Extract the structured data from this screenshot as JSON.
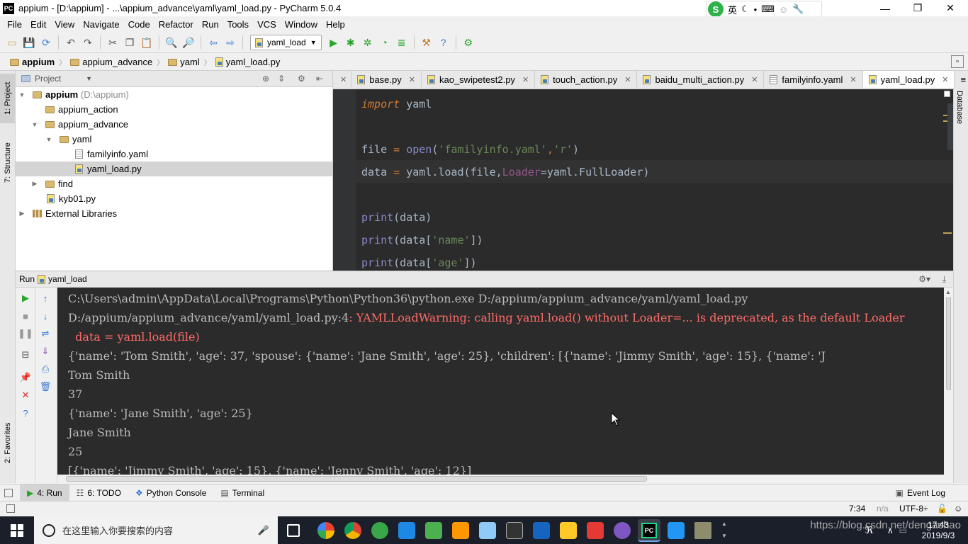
{
  "window": {
    "title": "appium - [D:\\appium] - ...\\appium_advance\\yaml\\yaml_load.py - PyCharm 5.0.4",
    "app_icon_text": "PC",
    "minimize": "—",
    "restore": "❐",
    "close": "✕"
  },
  "ime": {
    "logo": "S",
    "lang": "英",
    "icons": [
      "moon-icon",
      "dot-icon",
      "keyboard-icon",
      "person-icon",
      "wrench-icon"
    ]
  },
  "menu": [
    "File",
    "Edit",
    "View",
    "Navigate",
    "Code",
    "Refactor",
    "Run",
    "Tools",
    "VCS",
    "Window",
    "Help"
  ],
  "toolbar": {
    "run_config": "yaml_load"
  },
  "breadcrumb": [
    "appium",
    "appium_advance",
    "yaml",
    "yaml_load.py"
  ],
  "left_strip": {
    "project_tab": "1: Project",
    "structure_tab": "7: Structure",
    "favorites_tab": "2: Favorites"
  },
  "right_strip": {
    "database_tab": "Database"
  },
  "project_panel": {
    "selector": "Project",
    "tree": [
      {
        "label": "appium",
        "extra": "(D:\\appium)",
        "depth": 0,
        "expanded": true,
        "icon": "folder"
      },
      {
        "label": "appium_action",
        "depth": 1,
        "icon": "folder"
      },
      {
        "label": "appium_advance",
        "depth": 1,
        "expanded": true,
        "icon": "folder"
      },
      {
        "label": "yaml",
        "depth": 2,
        "expanded": true,
        "icon": "folder"
      },
      {
        "label": "familyinfo.yaml",
        "depth": 3,
        "icon": "yaml"
      },
      {
        "label": "yaml_load.py",
        "depth": 3,
        "icon": "py",
        "selected": true
      },
      {
        "label": "find",
        "depth": 1,
        "collapsed": true,
        "icon": "folder"
      },
      {
        "label": "kyb01.py",
        "depth": 1,
        "icon": "py"
      },
      {
        "label": "External Libraries",
        "depth": 0,
        "collapsed": true,
        "icon": "lib"
      }
    ]
  },
  "editor_tabs": [
    {
      "label": "base.py"
    },
    {
      "label": "kao_swipetest2.py"
    },
    {
      "label": "touch_action.py"
    },
    {
      "label": "baidu_multi_action.py"
    },
    {
      "label": "familyinfo.yaml",
      "icon": "yaml"
    },
    {
      "label": "yaml_load.py",
      "active": true
    }
  ],
  "tab_overflow": "≡",
  "code": {
    "l1_kw": "import",
    "l1_rest": " yaml",
    "l2_a": "file ",
    "l2_op": "=",
    "l2_fn": " open",
    "l2_b": "(",
    "l2_s1": "'familyinfo.yaml'",
    "l2_c": ",",
    "l2_s2": "'r'",
    "l2_d": ")",
    "l3_a": "data ",
    "l3_op": "=",
    "l3_b": " yaml.load(file,",
    "l3_param": "Loader",
    "l3_c": "=yaml.FullLoader)",
    "l4_fn": "print",
    "l4_b": "(data)",
    "l5_fn": "print",
    "l5_b": "(data[",
    "l5_s": "'name'",
    "l5_c": "])",
    "l6_fn": "print",
    "l6_b": "(data[",
    "l6_s": "'age'",
    "l6_c": "])"
  },
  "run_panel": {
    "label": "Run",
    "config": "yaml_load"
  },
  "console": [
    {
      "text": "C:\\Users\\admin\\AppData\\Local\\Programs\\Python\\Python36\\python.exe D:/appium/appium_advance/yaml/yaml_load.py",
      "kind": "normal"
    },
    {
      "link": "D:/appium/appium_advance/yaml/yaml_load.py:4",
      "text": ": YAMLLoadWarning: calling yaml.load() without Loader=... is deprecated, as the default Loader",
      "kind": "warn"
    },
    {
      "text": "  data = yaml.load(file)",
      "kind": "warn"
    },
    {
      "text": "{'name': 'Tom Smith', 'age': 37, 'spouse': {'name': 'Jane Smith', 'age': 25}, 'children': [{'name': 'Jimmy Smith', 'age': 15}, {'name': 'J",
      "kind": "normal"
    },
    {
      "text": "Tom Smith",
      "kind": "normal"
    },
    {
      "text": "37",
      "kind": "normal"
    },
    {
      "text": "{'name': 'Jane Smith', 'age': 25}",
      "kind": "normal"
    },
    {
      "text": "Jane Smith",
      "kind": "normal"
    },
    {
      "text": "25",
      "kind": "normal"
    },
    {
      "text": "[{'name': 'Jimmy Smith', 'age': 15}, {'name': 'Jenny Smith', 'age': 12}]",
      "kind": "normal"
    }
  ],
  "bottom_tabs": [
    {
      "label": "4: Run",
      "active": true
    },
    {
      "label": "6: TODO"
    },
    {
      "label": "Python Console"
    },
    {
      "label": "Terminal"
    }
  ],
  "event_log": "Event Log",
  "status": {
    "position": "7:34",
    "na": "n/a",
    "encoding": "UTF-8÷"
  },
  "taskbar": {
    "search_placeholder": "在这里输入你要搜索的内容",
    "time": "17:43",
    "date": "2019/9/3",
    "watermark": "https://blog.csdn.net/dengachao"
  }
}
